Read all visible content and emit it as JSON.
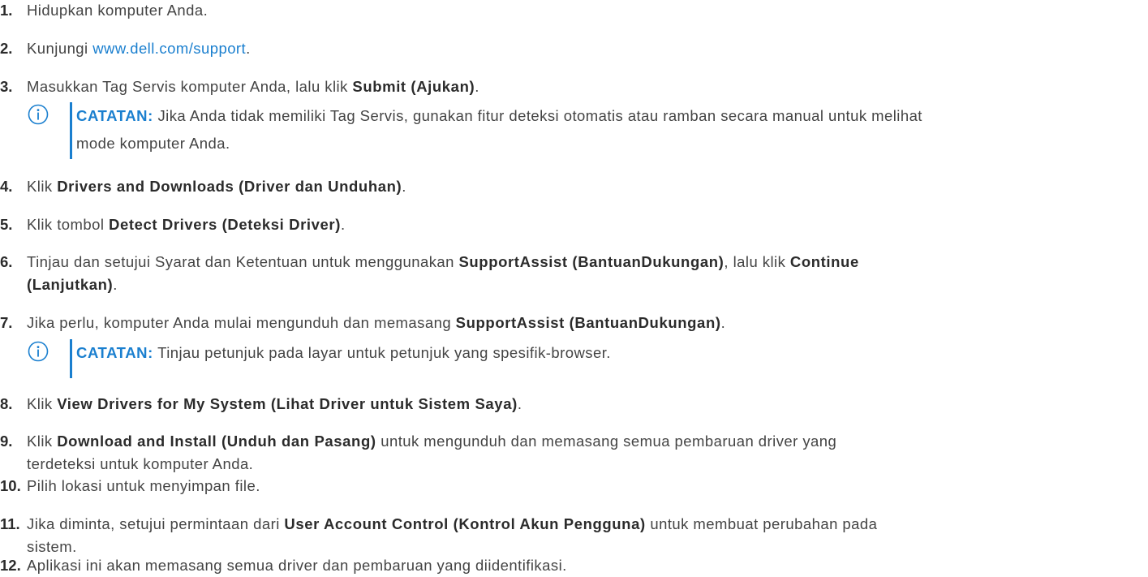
{
  "steps": [
    {
      "num": "1.",
      "text": "Hidupkan komputer Anda."
    },
    {
      "num": "2.",
      "pre": "Kunjungi ",
      "link": "www.dell.com/support",
      "post": "."
    },
    {
      "num": "3.",
      "pre": "Masukkan Tag Servis komputer Anda, lalu klik ",
      "bold": "Submit (Ajukan)",
      "post": "."
    },
    {
      "num": "4.",
      "pre": "Klik ",
      "bold": "Drivers and Downloads (Driver dan Unduhan)",
      "post": "."
    },
    {
      "num": "5.",
      "pre": "Klik tombol ",
      "bold": "Detect Drivers (Deteksi Driver)",
      "post": "."
    },
    {
      "num": "6.",
      "pre": "Tinjau dan setujui Syarat dan Ketentuan untuk menggunakan ",
      "bold": "SupportAssist (BantuanDukungan)",
      "mid": ", lalu klik ",
      "bold2a": "Continue",
      "bold2b": "(Lanjutkan)",
      "post": "."
    },
    {
      "num": "7.",
      "pre": "Jika perlu, komputer Anda mulai mengunduh dan memasang ",
      "bold": "SupportAssist (BantuanDukungan)",
      "post": "."
    },
    {
      "num": "8.",
      "pre": "Klik ",
      "bold": "View Drivers for My System (Lihat Driver untuk Sistem Saya)",
      "post": "."
    },
    {
      "num": "9.",
      "pre": "Klik ",
      "bold": "Download and Install (Unduh dan Pasang)",
      "post": " untuk mengunduh dan memasang semua pembaruan driver yang",
      "line2": "terdeteksi untuk komputer Anda."
    },
    {
      "num": "10.",
      "text": "Pilih lokasi untuk menyimpan file."
    },
    {
      "num": "11.",
      "pre": "Jika diminta, setujui permintaan dari ",
      "bold": "User Account Control (Kontrol Akun Pengguna)",
      "post": " untuk membuat perubahan pada",
      "line2": "sistem."
    },
    {
      "num": "12.",
      "text": "Aplikasi ini akan memasang semua driver dan pembaruan yang diidentifikasi."
    }
  ],
  "notes": {
    "note1": {
      "label": "CATATAN:",
      "text1": " Jika Anda tidak memiliki Tag Servis, gunakan fitur deteksi otomatis atau ramban secara manual untuk melihat",
      "text2": "mode komputer Anda."
    },
    "note2": {
      "label": "CATATAN:",
      "text1": " Tinjau petunjuk pada layar untuk petunjuk yang spesifik-browser."
    }
  },
  "icons": {
    "note_icon": "info-circle-icon",
    "accent_color": "#1a7fcf"
  }
}
